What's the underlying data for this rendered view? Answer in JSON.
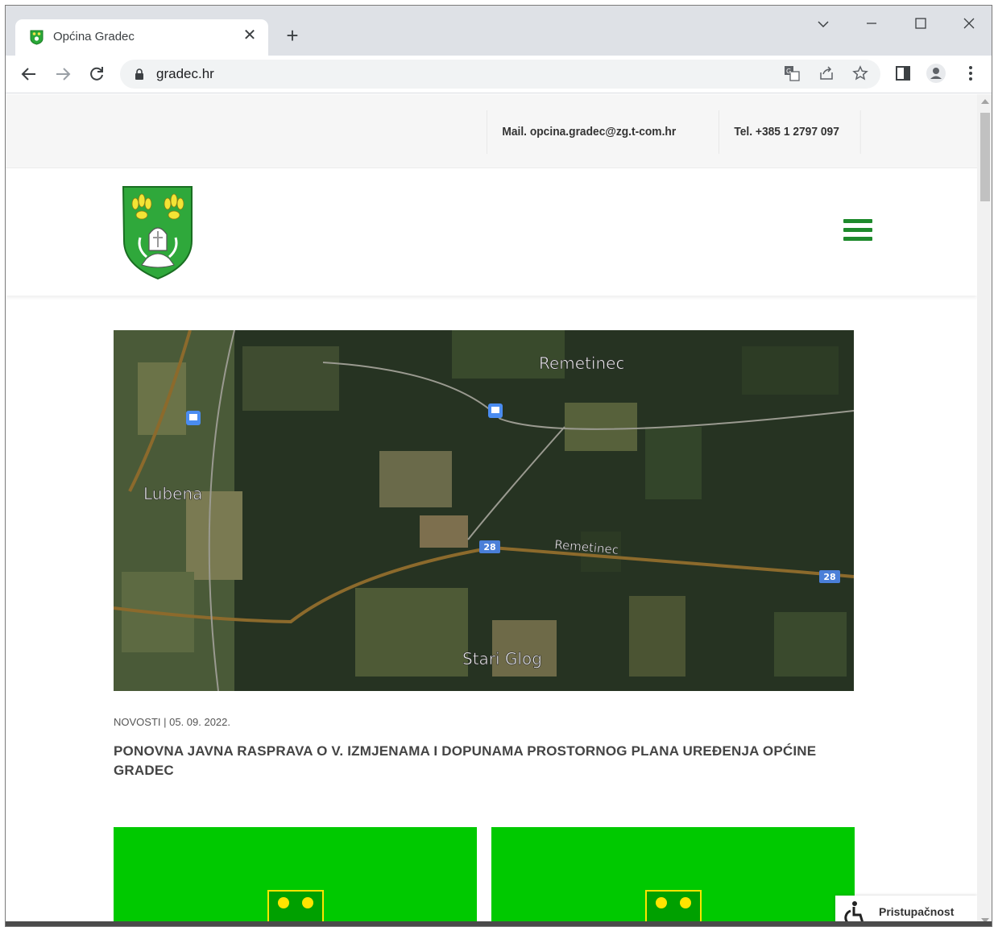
{
  "browser": {
    "tab_title": "Općina Gradec",
    "tab_close": "✕",
    "new_tab": "+",
    "url": "gradec.hr",
    "window_controls": {
      "dropdown": "⌄",
      "minimize": "—",
      "maximize": "☐",
      "close": "✕"
    },
    "nav": {
      "back": "←",
      "forward": "→",
      "reload": "⟳"
    },
    "toolbar_icons": [
      "translate-icon",
      "share-icon",
      "bookmark-star-icon",
      "side-panel-icon",
      "profile-icon",
      "menu-icon"
    ]
  },
  "contact": {
    "mail": "Mail. opcina.gradec@zg.t-com.hr",
    "tel": "Tel. +385 1 2797 097"
  },
  "map": {
    "labels": {
      "remetinec_top": "Remetinec",
      "lubena": "Lubena",
      "remetinec_road": "Remetinec",
      "stari_glog": "Stari Glog",
      "road_28": "28"
    }
  },
  "article": {
    "meta": "NOVOSTI | 05. 09. 2022.",
    "title": "PONOVNA JAVNA RASPRAVA O V. IZMJENAMA I DOPUNAMA PROSTORNOG PLANA UREĐENJA OPĆINE GRADEC"
  },
  "accessibility": {
    "label": "Pristupačnost"
  },
  "colors": {
    "brand_green": "#1e8a2c",
    "card_green": "#00c900",
    "shield_yellow": "#ffe400"
  }
}
